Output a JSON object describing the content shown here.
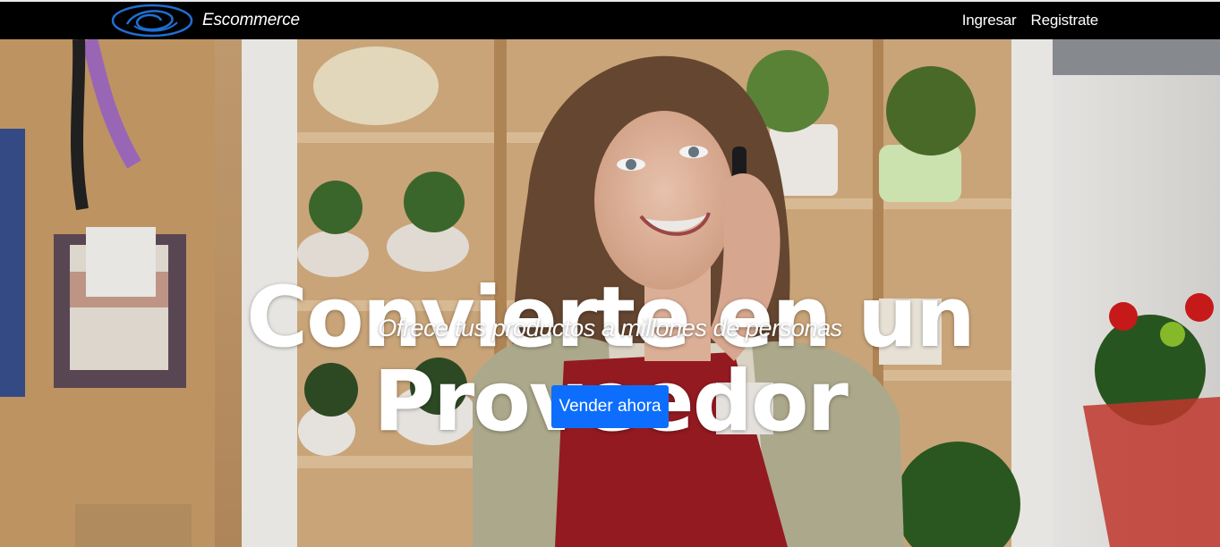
{
  "navbar": {
    "brand_name": "Escommerce",
    "links": [
      {
        "label": "Ingresar"
      },
      {
        "label": "Registrate"
      }
    ]
  },
  "hero": {
    "title": "Convierte en un Proveedor",
    "subtitle": "Ofrece tus productos a millones de personas",
    "cta_label": "Vender ahora",
    "background_image": "woman-in-red-apron-talking-on-phone-in-flower-gift-shop"
  },
  "colors": {
    "navbar_bg": "#000000",
    "cta_bg": "#0d6efd",
    "logo_stroke": "#1f6fd1",
    "text": "#ffffff"
  }
}
